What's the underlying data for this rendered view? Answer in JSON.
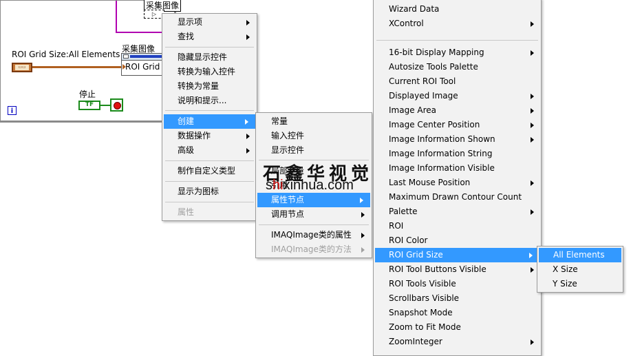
{
  "diagram": {
    "acquire_top_label": "采集图像",
    "roi_constant_label": "ROI Grid Size:All Elements",
    "acquire_label": "采集图像",
    "roi_node_text": "ROI Grid",
    "stop_label": "停止",
    "tf_text": "TF",
    "info_text": "i",
    "num_text": "U8"
  },
  "menu1": {
    "items": [
      {
        "label": "显示项",
        "arrow": true
      },
      {
        "label": "查找",
        "arrow": true
      },
      {
        "label": "隐藏显示控件"
      },
      {
        "label": "转换为输入控件"
      },
      {
        "label": "转换为常量"
      },
      {
        "label": "说明和提示..."
      },
      {
        "label": "创建",
        "arrow": true,
        "highlight": true
      },
      {
        "label": "数据操作",
        "arrow": true
      },
      {
        "label": "高级",
        "arrow": true
      },
      {
        "label": "制作自定义类型"
      },
      {
        "label": "显示为图标"
      },
      {
        "label": "属性",
        "disabled": true
      }
    ]
  },
  "menu2": {
    "items": [
      {
        "label": "常量"
      },
      {
        "label": "输入控件"
      },
      {
        "label": "显示控件"
      },
      {
        "label": "局部变量"
      },
      {
        "label": "引用"
      },
      {
        "label": "属性节点",
        "arrow": true,
        "highlight": true
      },
      {
        "label": "调用节点",
        "arrow": true
      },
      {
        "label": "IMAQImage类的属性",
        "arrow": true
      },
      {
        "label": "IMAQImage类的方法",
        "arrow": true,
        "disabled": true
      }
    ]
  },
  "menu3": {
    "items": [
      {
        "label": "Wizard Data"
      },
      {
        "label": "XControl",
        "arrow": true
      },
      {
        "label": "16-bit Display Mapping",
        "arrow": true
      },
      {
        "label": "Autosize Tools Palette"
      },
      {
        "label": "Current ROI Tool"
      },
      {
        "label": "Displayed Image",
        "arrow": true
      },
      {
        "label": "Image Area",
        "arrow": true
      },
      {
        "label": "Image Center Position",
        "arrow": true
      },
      {
        "label": "Image Information Shown",
        "arrow": true
      },
      {
        "label": "Image Information String"
      },
      {
        "label": "Image Information Visible"
      },
      {
        "label": "Last Mouse Position",
        "arrow": true
      },
      {
        "label": "Maximum Drawn Contour Count"
      },
      {
        "label": "Palette",
        "arrow": true
      },
      {
        "label": "ROI"
      },
      {
        "label": "ROI Color"
      },
      {
        "label": "ROI Grid Size",
        "arrow": true,
        "highlight": true
      },
      {
        "label": "ROI Tool Buttons Visible",
        "arrow": true
      },
      {
        "label": "ROI Tools Visible"
      },
      {
        "label": "Scrollbars Visible"
      },
      {
        "label": "Snapshot Mode"
      },
      {
        "label": "Zoom to Fit Mode"
      },
      {
        "label": "ZoomInteger",
        "arrow": true
      }
    ]
  },
  "menu4": {
    "items": [
      {
        "label": "All Elements",
        "highlight": true
      },
      {
        "label": "X Size"
      },
      {
        "label": "Y Size"
      }
    ]
  },
  "watermark": {
    "cn": "石鑫华视觉",
    "url_prefix": "s",
    "url_red": "hi",
    "url_rest": "xinhua.com"
  },
  "colors": {
    "highlight": "#3399ff",
    "menu_bg": "#f2f2f2",
    "wire_orange": "#b06020",
    "struct_purple": "#b000b0",
    "bool_green": "#1a8a1a"
  }
}
